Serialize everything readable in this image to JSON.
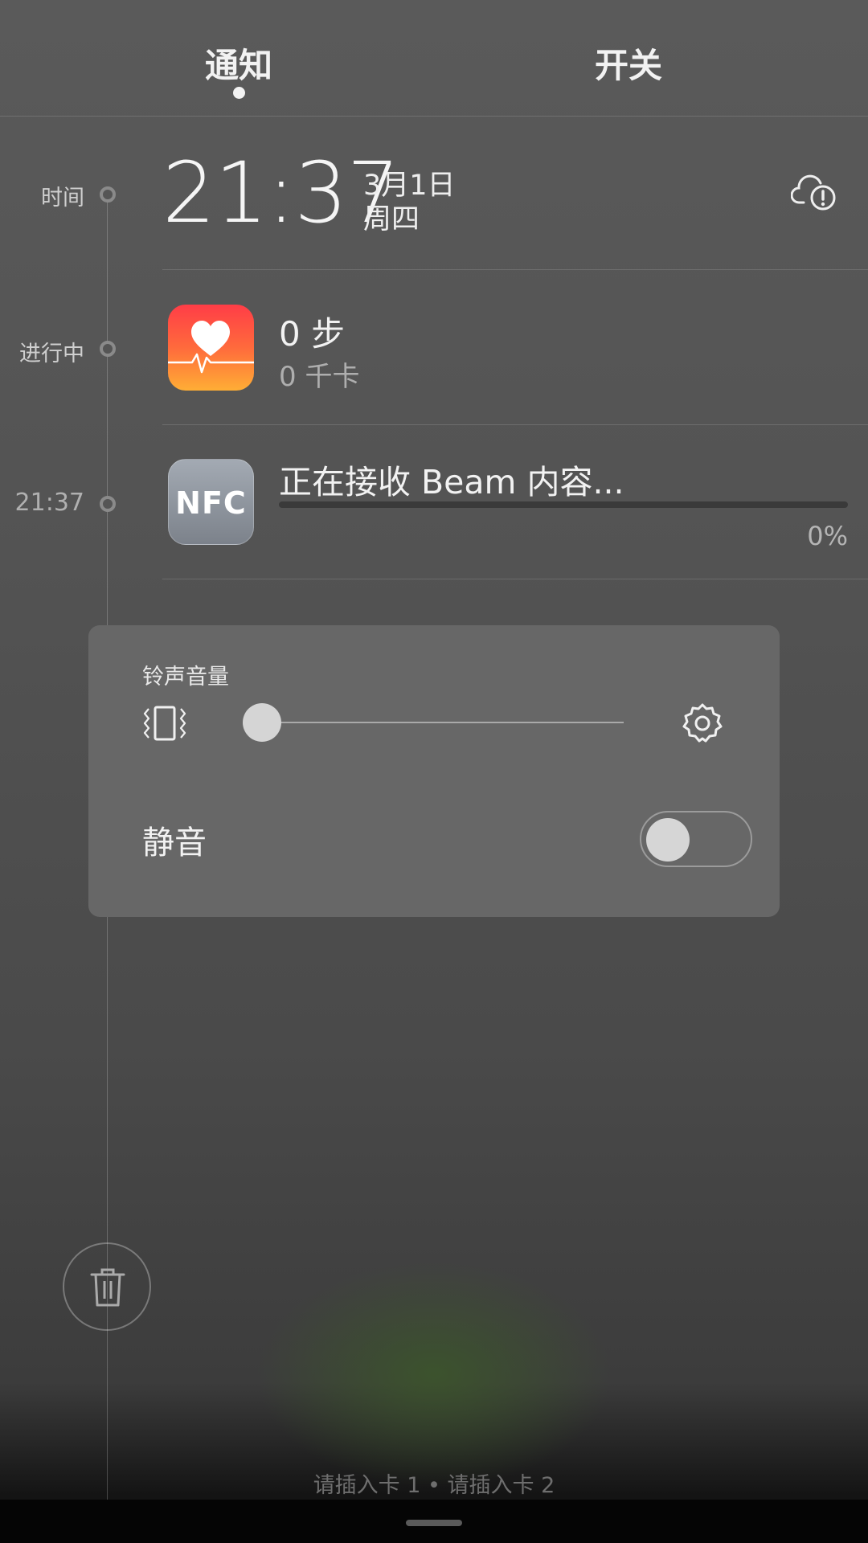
{
  "tabs": [
    {
      "label": "通知",
      "active": true
    },
    {
      "label": "开关",
      "active": false
    }
  ],
  "timeline": {
    "time_label": "时间",
    "ongoing_label": "进行中",
    "nfc_time": "21:37"
  },
  "clock": {
    "time": "21:37",
    "date": "3月1日",
    "weekday": "周四",
    "icon": "cloud-alert-icon"
  },
  "health": {
    "icon": "heart-pulse-icon",
    "steps": "0 步",
    "calories": "0 千卡",
    "colors": {
      "top": "#ff3d47",
      "bottom": "#ffae35"
    }
  },
  "nfc": {
    "icon_text": "NFC",
    "title": "正在接收 Beam 内容...",
    "progress": 0,
    "progress_text": "0%"
  },
  "volume_panel": {
    "title": "铃声音量",
    "vibrate_icon": "vibrate-icon",
    "settings_icon": "gear-icon",
    "volume_level": 0,
    "mute_label": "静音",
    "mute_on": false
  },
  "trash_icon": "trash-icon",
  "sim_status": "请插入卡 1 • 请插入卡 2"
}
